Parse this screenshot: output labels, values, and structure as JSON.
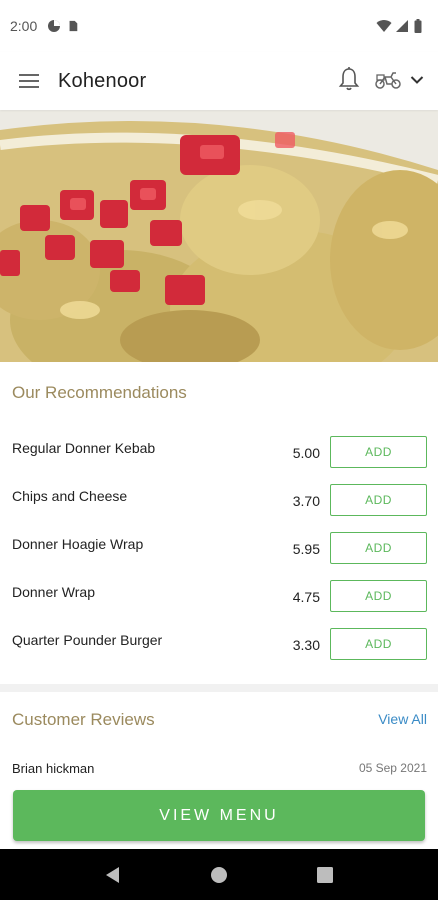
{
  "status_bar": {
    "time": "2:00",
    "icons_left": [
      "data-saver-icon",
      "sim-card-icon"
    ],
    "icons_right": [
      "wifi-icon",
      "signal-icon",
      "battery-icon"
    ]
  },
  "app_bar": {
    "title": "Kohenoor",
    "icons": [
      "menu-icon",
      "bell-icon",
      "scooter-icon",
      "chevron-down-icon"
    ]
  },
  "recommendations": {
    "title": "Our Recommendations",
    "items": [
      {
        "name": "Regular Donner Kebab",
        "price": "5.00",
        "button": "ADD"
      },
      {
        "name": "Chips and Cheese",
        "price": "3.70",
        "button": "ADD"
      },
      {
        "name": "Donner Hoagie Wrap",
        "price": "5.95",
        "button": "ADD"
      },
      {
        "name": "Donner Wrap",
        "price": "4.75",
        "button": "ADD"
      },
      {
        "name": "Quarter Pounder Burger",
        "price": "3.30",
        "button": "ADD"
      }
    ]
  },
  "reviews": {
    "title": "Customer Reviews",
    "view_all": "View All",
    "items": [
      {
        "author": "Brian hickman",
        "date": "05 Sep 2021"
      }
    ]
  },
  "cta": {
    "label": "VIEW MENU"
  },
  "colors": {
    "accent_green": "#5cb85c",
    "section_title": "#9b8a5e",
    "link_blue": "#3a8bc6"
  },
  "nav_bar": {
    "buttons": [
      "back-icon",
      "home-icon",
      "recents-icon"
    ]
  }
}
